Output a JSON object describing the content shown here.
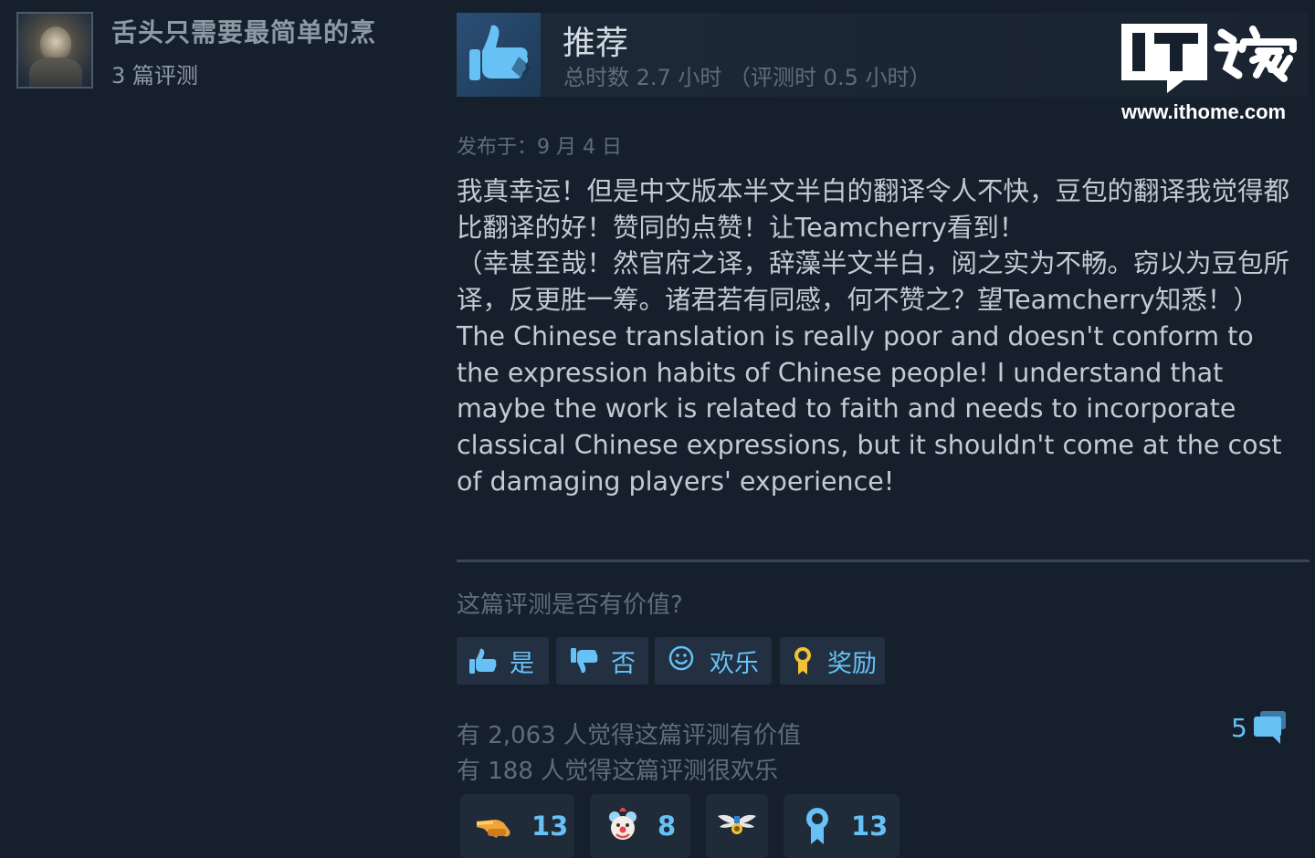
{
  "author": {
    "name": "舌头只需要最简单的烹",
    "review_count": "3 篇评测"
  },
  "review": {
    "verdict": "推荐",
    "hours": "总时数 2.7 小时 （评测时 0.5 小时）",
    "posted": "发布于：9 月 4 日",
    "paragraphs": [
      "我真幸运！但是中文版本半文半白的翻译令人不快，豆包的翻译我觉得都比翻译的好！赞同的点赞！让Teamcherry看到！",
      "（幸甚至哉！然官府之译，辞藻半文半白，阅之实为不畅。窃以为豆包所译，反更胜一筹。诸君若有同感，何不赞之？望Teamcherry知悉！）",
      "The Chinese translation is really poor and doesn't conform to the expression habits of Chinese people! I understand that maybe the work is related to faith and needs to incorporate classical Chinese expressions, but it shouldn't come at the cost of damaging players' experience!"
    ]
  },
  "feedback": {
    "question": "这篇评测是否有价值?",
    "buttons": {
      "yes": "是",
      "no": "否",
      "funny": "欢乐",
      "award": "奖励"
    },
    "helpful_stat": "有 2,063 人觉得这篇评测有价值",
    "funny_stat": "有 188 人觉得这篇评测很欢乐",
    "comment_count": "5"
  },
  "awards": [
    {
      "icon": "pointing-hand-icon",
      "count": "13"
    },
    {
      "icon": "clown-face-icon",
      "count": "8"
    },
    {
      "icon": "winged-medal-icon",
      "count": ""
    },
    {
      "icon": "ribbon-medal-icon",
      "count": "13"
    }
  ],
  "watermark": {
    "logo_text": "IT之家",
    "url": "www.ithome.com"
  },
  "colors": {
    "background": "#16202d",
    "link_blue": "#67c1f5",
    "muted_text": "#5f6d79",
    "body_text": "#c1cbd3",
    "button_bg": "#223041"
  }
}
